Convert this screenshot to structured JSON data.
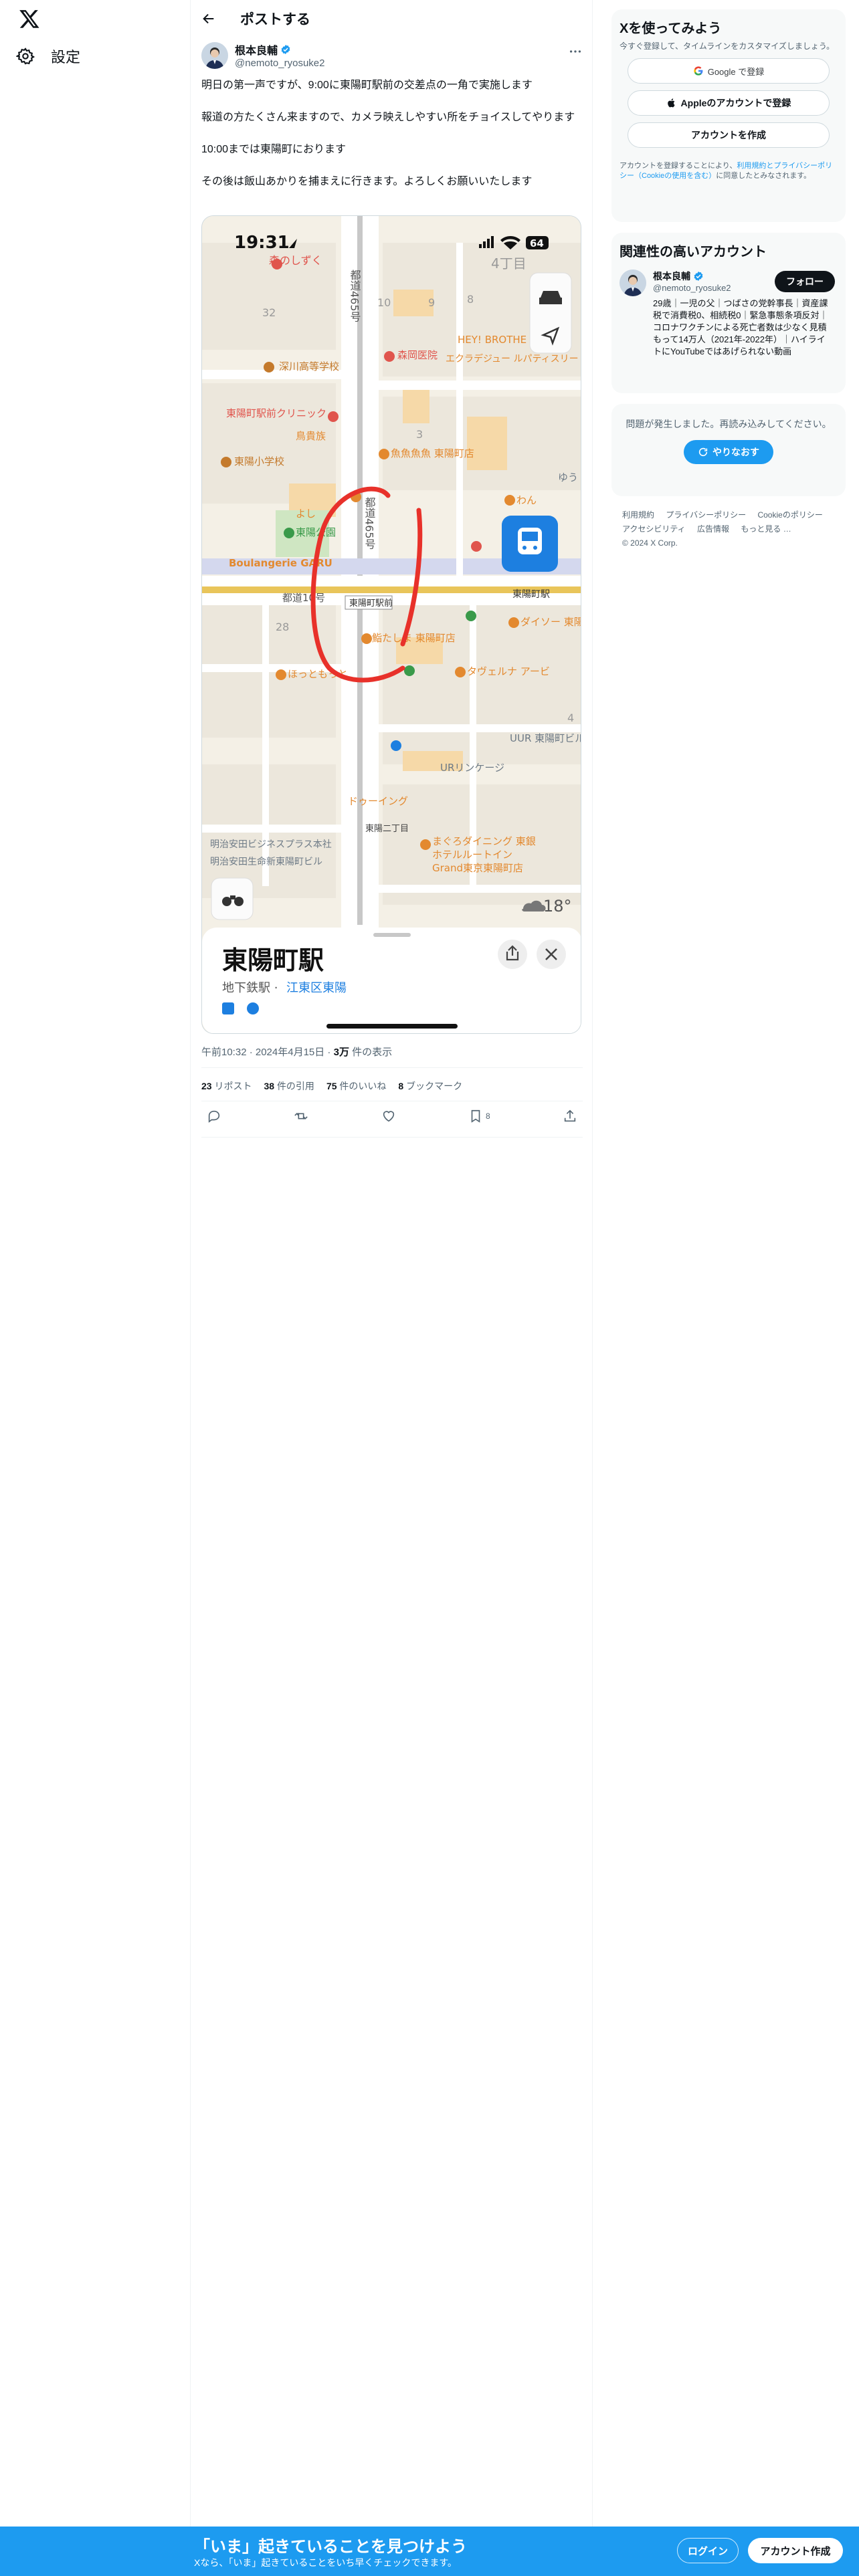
{
  "nav": {
    "logo_icon": "x-logo-icon",
    "settings_label": "設定"
  },
  "header": {
    "title": "ポストする"
  },
  "tweet": {
    "display_name": "根本良輔",
    "handle": "@nemoto_ryosuke2",
    "paragraphs": [
      "明日の第一声ですが、9:00に東陽町駅前の交差点の一角で実施します",
      "報道の方たくさん来ますので、カメラ映えしやすい所をチョイスしてやります",
      "10:00までは東陽町におります",
      "その後は飯山あかりを捕まえに行きます。よろしくお願いいたします"
    ],
    "timestamp": "午前10:32 · 2024年4月15日",
    "views_count": "3万",
    "views_label": "件の表示",
    "stats": [
      {
        "count": "23",
        "label": "リポスト"
      },
      {
        "count": "38",
        "label": "件の引用"
      },
      {
        "count": "75",
        "label": "件のいいね"
      },
      {
        "count": "8",
        "label": "ブックマーク"
      }
    ],
    "bookmark_count": "8"
  },
  "map_screenshot": {
    "status_time": "19:31",
    "battery": "64",
    "chome_label": "4丁目",
    "block_numbers": [
      "32",
      "10",
      "9",
      "8",
      "3",
      "28",
      "4"
    ],
    "road_labels": [
      "都道465号",
      "都道465号",
      "都道10号"
    ],
    "places": [
      {
        "name": "森のしずく",
        "color": "#e0554d"
      },
      {
        "name": "深川高等学校",
        "color": "#c47a2c"
      },
      {
        "name": "森岡医院",
        "color": "#e0554d"
      },
      {
        "name": "HEY! BROTHE",
        "color": "#e3892f"
      },
      {
        "name": "エクラデジュー ルパティスリー",
        "color": "#e3892f"
      },
      {
        "name": "東陽町駅前クリニック",
        "color": "#e0554d"
      },
      {
        "name": "鳥貴族",
        "color": "#e3892f"
      },
      {
        "name": "魚魚魚魚 東陽町店",
        "color": "#e3892f"
      },
      {
        "name": "東陽小学校",
        "color": "#c47a2c"
      },
      {
        "name": "わん",
        "color": "#e3892f"
      },
      {
        "name": "ゆう",
        "color": "#6d7a86"
      },
      {
        "name": "よし",
        "color": "#e3892f"
      },
      {
        "name": "東陽公園",
        "color": "#3a9a4a"
      },
      {
        "name": "Boulangerie GARU",
        "color": "#e3892f"
      },
      {
        "name": "東陽町駅",
        "color": "#333333"
      },
      {
        "name": "ダイソー 東陽",
        "color": "#e3892f"
      },
      {
        "name": "鮨たしま 東陽町店",
        "color": "#e3892f"
      },
      {
        "name": "ほっともっと",
        "color": "#e3892f"
      },
      {
        "name": "タヴェルナ アービ",
        "color": "#e3892f"
      },
      {
        "name": "UUR 東陽町ビル",
        "color": "#6d7a86"
      },
      {
        "name": "URリンケージ",
        "color": "#6d7a86"
      },
      {
        "name": "ドゥーイング",
        "color": "#e3892f"
      },
      {
        "name": "東陽二丁目",
        "color": "#444444"
      },
      {
        "name": "明治安田ビジネスプラス本社",
        "color": "#6d7a86"
      },
      {
        "name": "明治安田生命新東陽町ビル",
        "color": "#6d7a86"
      },
      {
        "name": "まぐろダイニング 東銀",
        "color": "#e3892f"
      },
      {
        "name": "ホテルルートイン",
        "color": "#e3892f"
      },
      {
        "name": "Grand東京東陽町店",
        "color": "#e3892f"
      }
    ],
    "station_box_label": "東陽町駅前",
    "temperature": "18°",
    "sheet_title": "東陽町駅",
    "sheet_subtitle_prefix": "地下鉄駅 · ",
    "sheet_subtitle_link": "江東区東陽"
  },
  "sidebar": {
    "signup": {
      "title": "Xを使ってみよう",
      "subtitle": "今すぐ登録して、タイムラインをカスタマイズしましょう。",
      "google_label": "Google で登録",
      "apple_label": "Appleのアカウントで登録",
      "create_label": "アカウントを作成",
      "terms_prefix": "アカウントを登録することにより、",
      "terms_link": "利用規約とプライバシーポリシー（Cookieの使用を含む）",
      "terms_suffix": "に同意したとみなされます。"
    },
    "relevant": {
      "title": "関連性の高いアカウント",
      "name": "根本良輔",
      "handle": "@nemoto_ryosuke2",
      "follow_label": "フォロー",
      "bio": "29歳｜一児の父｜つばさの党幹事長｜資産課税で消費税0、相続税0｜緊急事態条項反対｜コロナワクチンによる死亡者数は少なく見積もって14万人（2021年-2022年）｜ハイライトにYouTubeではあげられない動画"
    },
    "error": {
      "message": "問題が発生しました。再読み込みしてください。",
      "retry_label": "やりなおす"
    },
    "footer_links": [
      "利用規約",
      "プライバシーポリシー",
      "Cookieのポリシー",
      "アクセシビリティ",
      "広告情報",
      "もっと見る …",
      "© 2024 X Corp."
    ]
  },
  "banner": {
    "title": "「いま」起きていることを見つけよう",
    "subtitle": "Xなら、「いま」起きていることをいち早くチェックできます。",
    "login_label": "ログイン",
    "create_label": "アカウント作成"
  },
  "colors": {
    "accent": "#1d9bf0",
    "text": "#0f1419",
    "muted": "#536471",
    "transit": "#1d7fe0",
    "annotation": "#e8312a"
  }
}
